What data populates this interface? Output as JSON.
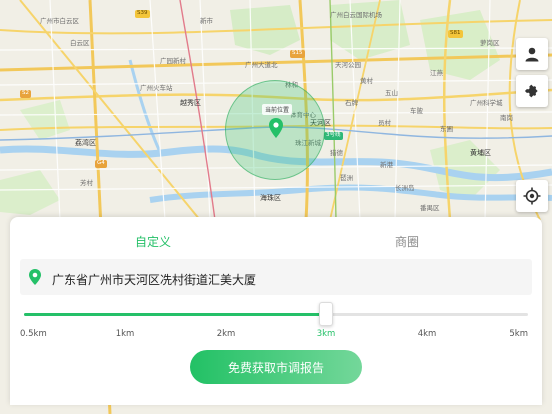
{
  "map": {
    "current_location_tag": "当前位置",
    "labels": [
      "广州市白云区",
      "白云区",
      "广州白云国际机场",
      "新市",
      "广园新村",
      "广州大道北",
      "黄村",
      "天河公园",
      "林和",
      "越秀区",
      "广州火车站",
      "海珠区",
      "荔湾区",
      "芳村",
      "番禺区",
      "天河区",
      "员村",
      "车陂",
      "东圃",
      "黄埔区",
      "广州科学城",
      "萝岗区",
      "长洲岛",
      "南岗",
      "江燕",
      "石牌",
      "五山",
      "猎德",
      "琶洲",
      "新港",
      "珠江新城",
      "体育中心"
    ],
    "road_badges": [
      "S15",
      "G4",
      "S81",
      "S39",
      "S2"
    ],
    "metro_tag": "3号线"
  },
  "controls": {
    "person_icon": "person-icon",
    "puzzle_icon": "puzzle-icon",
    "locate_icon": "target-locate-icon"
  },
  "panel": {
    "tabs": [
      {
        "label": "自定义",
        "active": true
      },
      {
        "label": "商圈",
        "active": false
      }
    ],
    "address": "广东省广州市天河区冼村街道汇美大厦",
    "slider": {
      "ticks": [
        "0.5km",
        "1km",
        "2km",
        "3km",
        "4km",
        "5km"
      ],
      "selected": "3km",
      "selected_fraction": 0.6
    },
    "report_button": "免费获取市调报告"
  },
  "colors": {
    "accent": "#25c068",
    "radius_fill": "#34c46e"
  }
}
